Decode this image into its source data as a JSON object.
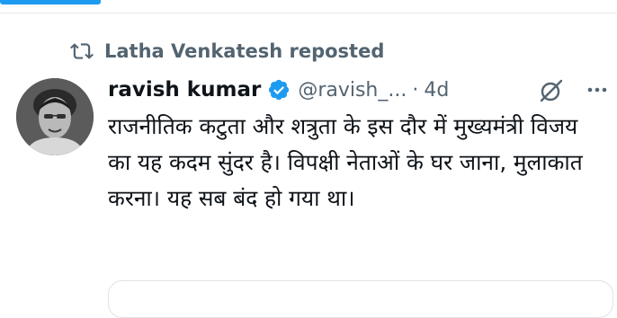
{
  "repost": {
    "text": "Latha Venkatesh reposted",
    "icon": "repost-icon"
  },
  "tweet": {
    "author_name": "ravish kumar",
    "handle": "@ravish_...",
    "separator": "·",
    "time": "4d",
    "verified": true,
    "text": "राजनीतिक कटुता और शत्रुता के इस दौर में मुख्यमंत्री विजय का यह कदम सुंदर है। विपक्षी नेताओं के घर जाना, मुलाकात करना। यह सब बंद हो गया था।"
  },
  "icons": {
    "verified": "verified-badge-icon",
    "grok": "grok-icon",
    "more": "more-options-icon"
  },
  "colors": {
    "accent": "#1d9bf0",
    "secondary_text": "#536471",
    "primary_text": "#0f1419"
  }
}
